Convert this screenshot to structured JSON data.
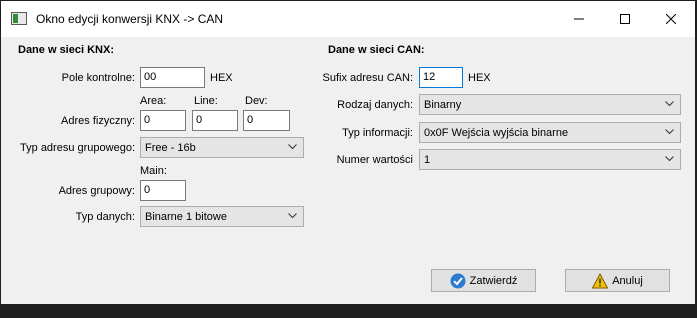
{
  "window": {
    "title": "Okno edycji konwersji KNX -> CAN",
    "icon": "app-icon",
    "controls": [
      "minimize-icon",
      "maximize-icon",
      "close-icon"
    ]
  },
  "knx": {
    "section_title": "Dane w sieci KNX:",
    "control_field": {
      "label": "Pole kontrolne:",
      "value": "00",
      "unit": "HEX"
    },
    "physical_address": {
      "label": "Adres fizyczny:",
      "area_label": "Area:",
      "area_value": "0",
      "line_label": "Line:",
      "line_value": "0",
      "dev_label": "Dev:",
      "dev_value": "0"
    },
    "group_address_type": {
      "label": "Typ adresu grupowego:",
      "value": "Free - 16b"
    },
    "group_address": {
      "label": "Adres grupowy:",
      "main_label": "Main:",
      "main_value": "0"
    },
    "data_type": {
      "label": "Typ danych:",
      "value": "Binarne 1 bitowe"
    }
  },
  "can": {
    "section_title": "Dane w sieci CAN:",
    "address_suffix": {
      "label": "Sufix adresu CAN:",
      "value": "12",
      "unit": "HEX"
    },
    "data_kind": {
      "label": "Rodzaj danych:",
      "value": "Binarny"
    },
    "info_type": {
      "label": "Typ informacji:",
      "value": "0x0F Wejścia wyjścia binarne"
    },
    "value_number": {
      "label": "Numer wartości",
      "value": "1"
    }
  },
  "buttons": {
    "confirm": {
      "label": "Zatwierdź",
      "icon": "check-icon",
      "color": "#2b7bd1"
    },
    "cancel": {
      "label": "Anuluj",
      "icon": "warning-icon",
      "color": "#f2c200"
    }
  }
}
